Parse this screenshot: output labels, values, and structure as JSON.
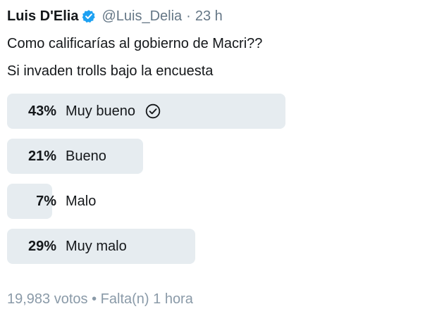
{
  "tweet": {
    "author_name": "Luis D'Elia",
    "handle": "@Luis_Delia",
    "separator": "·",
    "time": "23 h",
    "text_line1": "Como calificarías al gobierno de Macri??",
    "text_line2": "Si invaden trolls bajo la encuesta"
  },
  "poll": {
    "options": [
      {
        "percent": "43%",
        "label": "Muy bueno",
        "fraction": 0.43,
        "selected": true
      },
      {
        "percent": "21%",
        "label": "Bueno",
        "fraction": 0.21,
        "selected": false
      },
      {
        "percent": "7%",
        "label": "Malo",
        "fraction": 0.07,
        "selected": false
      },
      {
        "percent": "29%",
        "label": "Muy malo",
        "fraction": 0.29,
        "selected": false
      }
    ],
    "votes": "19,983 votos",
    "footer_separator": "•",
    "time_left": "Falta(n) 1 hora"
  },
  "colors": {
    "bar": "#e6ecf0",
    "verified": "#1da1f2",
    "secondary_text": "#657786"
  }
}
